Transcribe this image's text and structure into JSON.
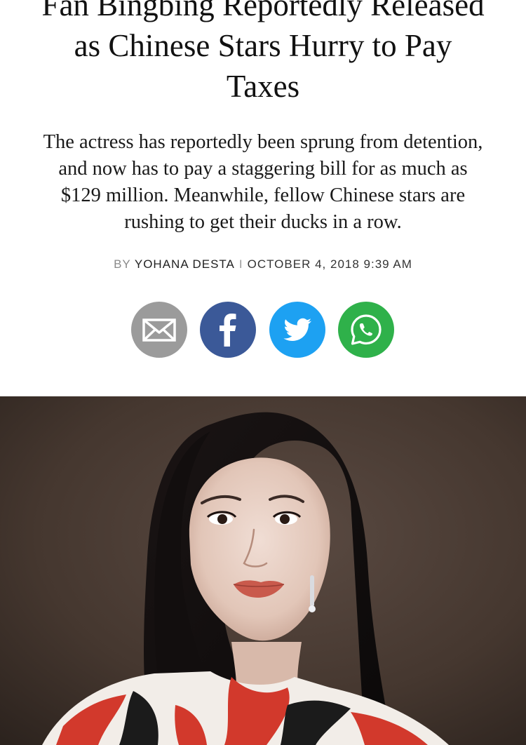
{
  "article": {
    "headline_lines": [
      "Fan Bingbing Reportedly Released",
      "as Chinese Stars Hurry to Pay",
      "Taxes"
    ],
    "dek_lines": [
      "The actress has reportedly been sprung from detention,",
      "and now has to pay a staggering bill for as much as",
      "$129 million. Meanwhile, fellow Chinese stars are",
      "rushing to get their ducks in a row."
    ],
    "byline": {
      "by": "BY",
      "author": "YOHANA DESTA",
      "separator": "I",
      "date": "OCTOBER 4, 2018 9:39 AM"
    }
  },
  "share": {
    "buttons": [
      {
        "icon": "envelope-icon",
        "color": "#9b9b9b"
      },
      {
        "icon": "facebook-icon",
        "color": "#3b5998"
      },
      {
        "icon": "twitter-icon",
        "color": "#1da1f2"
      },
      {
        "icon": "whatsapp-icon",
        "color": "#2fb14a"
      }
    ]
  },
  "hero": {
    "image": "portrait-photo",
    "background_color": "#4a3c35"
  }
}
